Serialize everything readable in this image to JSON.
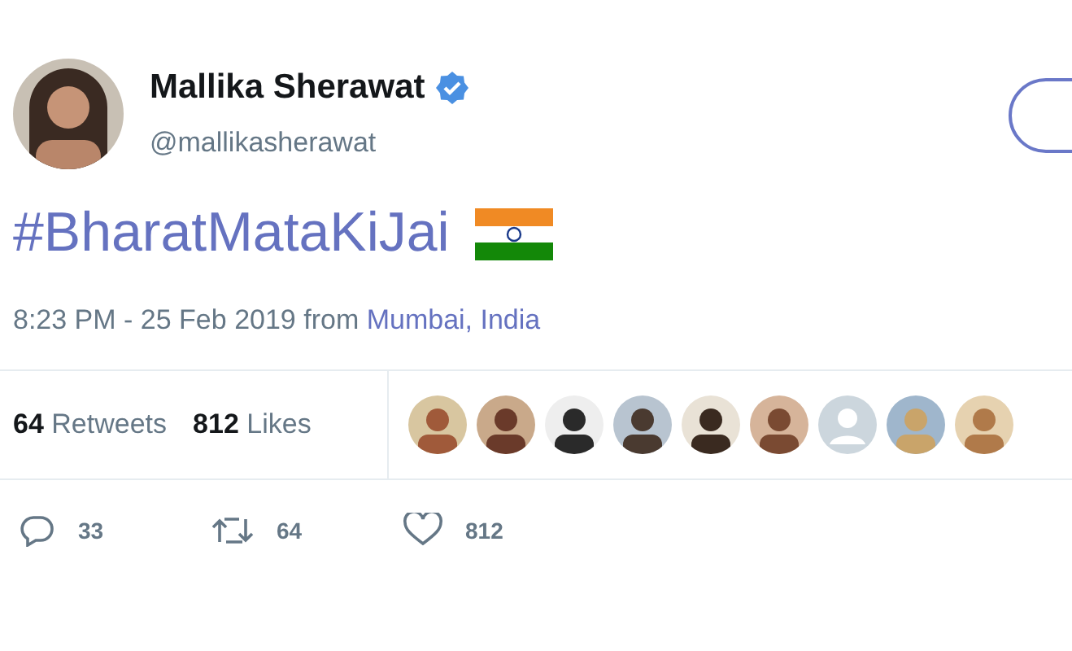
{
  "author": {
    "name": "Mallika Sherawat",
    "verified": true,
    "handle": "@mallikasherawat"
  },
  "tweet": {
    "hashtag": "#BharatMataKiJai",
    "timestamp": "8:23 PM - 25 Feb 2019 from ",
    "location": "Mumbai, India"
  },
  "stats": [
    {
      "count": "64",
      "label": "Retweets"
    },
    {
      "count": "812",
      "label": "Likes"
    }
  ],
  "likers": [
    {
      "kind": "picture"
    },
    {
      "kind": "picture"
    },
    {
      "kind": "picture"
    },
    {
      "kind": "picture"
    },
    {
      "kind": "picture"
    },
    {
      "kind": "picture"
    },
    {
      "kind": "default"
    },
    {
      "kind": "picture"
    },
    {
      "kind": "picture"
    }
  ],
  "actions": [
    {
      "kind": "reply",
      "count": "33"
    },
    {
      "kind": "retweet",
      "count": "64"
    },
    {
      "kind": "like",
      "count": "812"
    }
  ]
}
